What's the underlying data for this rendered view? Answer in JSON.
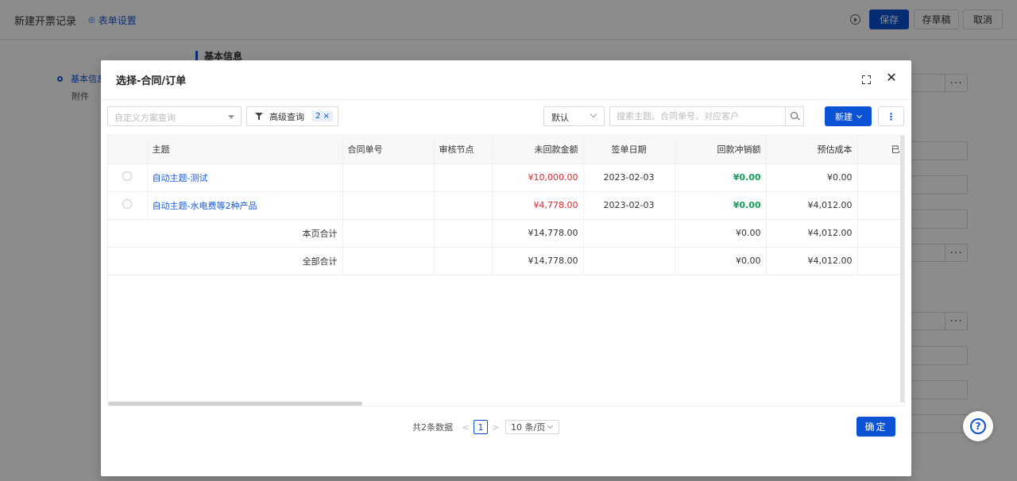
{
  "page": {
    "title": "新建开票记录",
    "form_settings": "表单设置",
    "buttons": {
      "save": "保存",
      "draft": "存草稿",
      "cancel": "取消"
    },
    "side_nav": [
      "基本信息",
      "附件"
    ],
    "section_title": "基本信息"
  },
  "modal": {
    "title": "选择-合同/订单",
    "toolbar": {
      "scheme_placeholder": "自定义方案查询",
      "advanced_query": "高级查询",
      "advanced_badge": "2 ×",
      "sort_value": "默认",
      "search_placeholder": "搜索主题、合同单号、对应客户",
      "new_label": "新建",
      "more_label": "⋮"
    },
    "table": {
      "columns": [
        "主题",
        "合同单号",
        "审核节点",
        "未回款金额",
        "签单日期",
        "回款冲销额",
        "预估成本",
        "已发"
      ],
      "rows": [
        {
          "subject": "自动主题-测试",
          "contract_no": "",
          "audit_node": "",
          "unpaid": "¥10,000.00",
          "sign_date": "2023-02-03",
          "writeoff": "¥0.00",
          "est_cost": "¥0.00"
        },
        {
          "subject": "自动主题-水电费等2种产品",
          "contract_no": "",
          "audit_node": "",
          "unpaid": "¥4,778.00",
          "sign_date": "2023-02-03",
          "writeoff": "¥0.00",
          "est_cost": "¥4,012.00"
        }
      ],
      "summary": [
        {
          "label": "本页合计",
          "unpaid": "¥14,778.00",
          "writeoff": "¥0.00",
          "est_cost": "¥4,012.00"
        },
        {
          "label": "全部合计",
          "unpaid": "¥14,778.00",
          "writeoff": "¥0.00",
          "est_cost": "¥4,012.00"
        }
      ]
    },
    "pagination": {
      "total": "共2条数据",
      "current": "1",
      "page_size": "10 条/页"
    },
    "confirm": "确定"
  },
  "help": "?",
  "colors": {
    "primary": "#0c52d4",
    "negative": "#e0262e",
    "positive": "#15a05a"
  }
}
